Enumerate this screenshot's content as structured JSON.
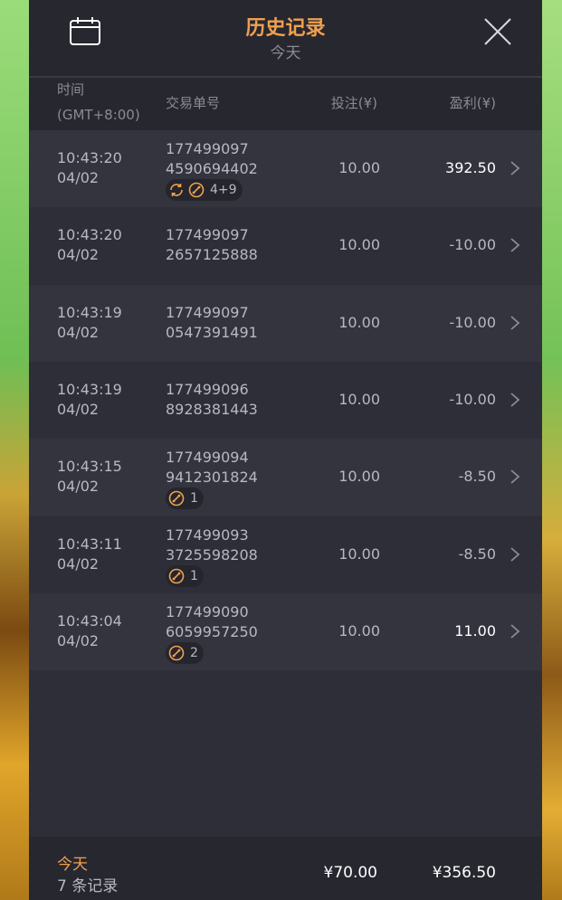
{
  "header": {
    "title": "历史记录",
    "subtitle": "今天"
  },
  "columns": {
    "time_label": "时间",
    "timezone": "(GMT+8:00)",
    "order_label": "交易单号",
    "bet_label": "投注(¥)",
    "pnl_label": "盈利(¥)"
  },
  "rows": [
    {
      "time": "10:43:20",
      "date": "04/02",
      "order_line1": "177499097",
      "order_line2": "4590694402",
      "bet": "10.00",
      "pnl": "392.50",
      "tag_icons": [
        "refresh-icon",
        "multiplier-icon"
      ],
      "tag_text": "4+9"
    },
    {
      "time": "10:43:20",
      "date": "04/02",
      "order_line1": "177499097",
      "order_line2": "2657125888",
      "bet": "10.00",
      "pnl": "-10.00"
    },
    {
      "time": "10:43:19",
      "date": "04/02",
      "order_line1": "177499097",
      "order_line2": "0547391491",
      "bet": "10.00",
      "pnl": "-10.00"
    },
    {
      "time": "10:43:19",
      "date": "04/02",
      "order_line1": "177499096",
      "order_line2": "8928381443",
      "bet": "10.00",
      "pnl": "-10.00"
    },
    {
      "time": "10:43:15",
      "date": "04/02",
      "order_line1": "177499094",
      "order_line2": "9412301824",
      "bet": "10.00",
      "pnl": "-8.50",
      "tag_icons": [
        "multiplier-icon"
      ],
      "tag_text": "1"
    },
    {
      "time": "10:43:11",
      "date": "04/02",
      "order_line1": "177499093",
      "order_line2": "3725598208",
      "bet": "10.00",
      "pnl": "-8.50",
      "tag_icons": [
        "multiplier-icon"
      ],
      "tag_text": "1"
    },
    {
      "time": "10:43:04",
      "date": "04/02",
      "order_line1": "177499090",
      "order_line2": "6059957250",
      "bet": "10.00",
      "pnl": "11.00",
      "tag_icons": [
        "multiplier-icon"
      ],
      "tag_text": "2"
    }
  ],
  "footer": {
    "label": "今天",
    "count": "7 条记录",
    "total_bet": "¥70.00",
    "total_pnl": "¥356.50"
  },
  "colors": {
    "accent": "#f0a050",
    "panel": "#2e2e38",
    "row_alt": "#34343e",
    "header": "#272730",
    "text": "#b8b8c0",
    "muted": "#8b8b95"
  }
}
